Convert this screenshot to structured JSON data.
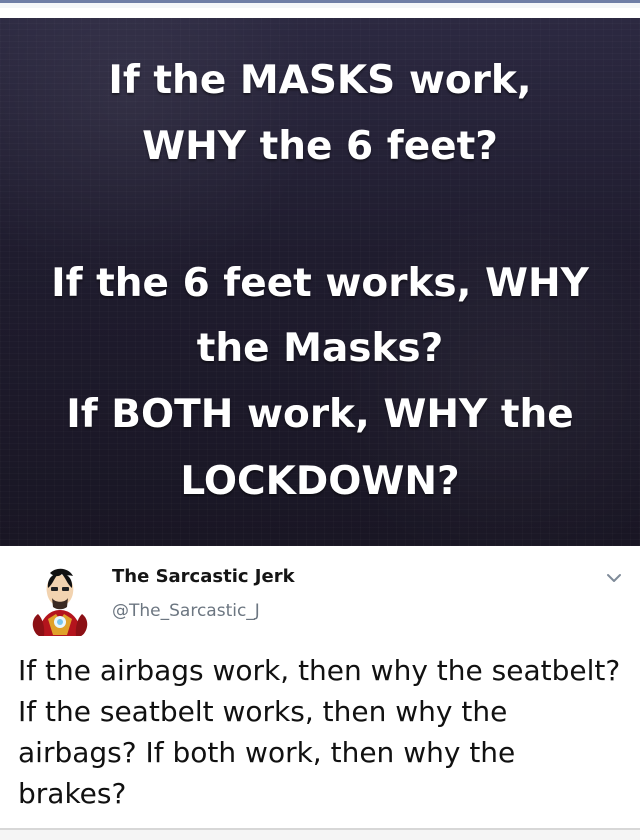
{
  "meme": {
    "lines": [
      "If the MASKS work,",
      "WHY the 6 feet?",
      "If the 6 feet works, WHY",
      "the Masks?",
      "If BOTH work, WHY the",
      "LOCKDOWN?"
    ]
  },
  "tweet": {
    "author_name": "The Sarcastic Jerk",
    "author_handle": "@The_Sarcastic_J",
    "body": "If the airbags work, then why the seatbelt? If the seatbelt works, then why the airbags? If both work, then why the brakes?"
  },
  "icons": {
    "avatar": "avatar-icon",
    "chevron": "chevron-down-icon"
  },
  "colors": {
    "meme_background": "#1f1c2e",
    "meme_text": "#ffffff",
    "tweet_text": "#111111",
    "handle_text": "#6c7681"
  }
}
